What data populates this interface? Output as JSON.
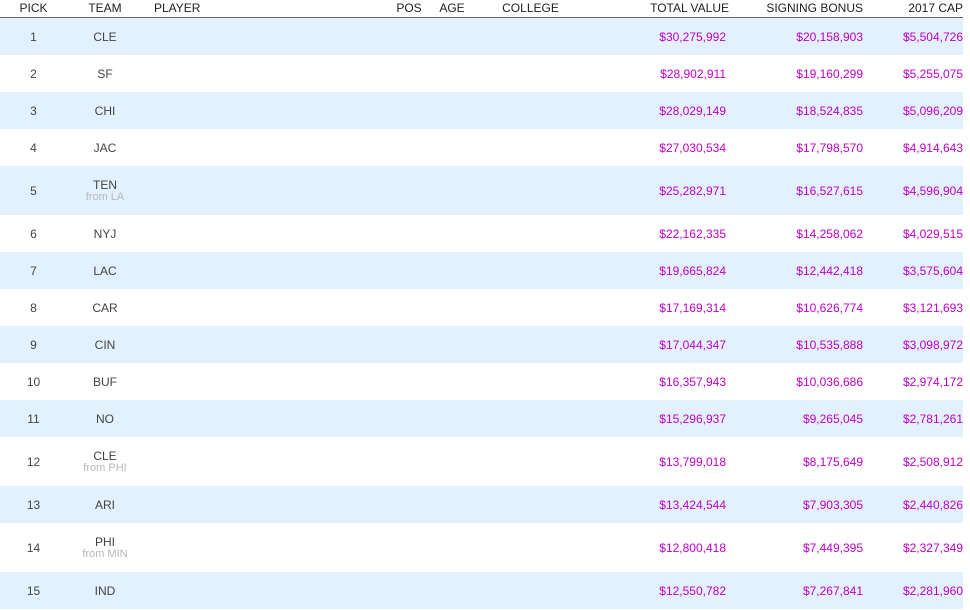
{
  "headers": {
    "pick": "PICK",
    "team": "TEAM",
    "player": "PLAYER",
    "pos": "POS",
    "age": "AGE",
    "college": "COLLEGE",
    "total_value": "TOTAL VALUE",
    "signing_bonus": "SIGNING BONUS",
    "cap_2017": "2017 CAP"
  },
  "colors": {
    "money": "#c000c8",
    "alt_row": "#e3f0fd",
    "from_text": "#b8b8b8"
  },
  "rows": [
    {
      "pick": "1",
      "team": "CLE",
      "from": "",
      "total": "$30,275,992",
      "bonus": "$20,158,903",
      "cap": "$5,504,726"
    },
    {
      "pick": "2",
      "team": "SF",
      "from": "",
      "total": "$28,902,911",
      "bonus": "$19,160,299",
      "cap": "$5,255,075"
    },
    {
      "pick": "3",
      "team": "CHI",
      "from": "",
      "total": "$28,029,149",
      "bonus": "$18,524,835",
      "cap": "$5,096,209"
    },
    {
      "pick": "4",
      "team": "JAC",
      "from": "",
      "total": "$27,030,534",
      "bonus": "$17,798,570",
      "cap": "$4,914,643"
    },
    {
      "pick": "5",
      "team": "TEN",
      "from": "from LA",
      "total": "$25,282,971",
      "bonus": "$16,527,615",
      "cap": "$4,596,904"
    },
    {
      "pick": "6",
      "team": "NYJ",
      "from": "",
      "total": "$22,162,335",
      "bonus": "$14,258,062",
      "cap": "$4,029,515"
    },
    {
      "pick": "7",
      "team": "LAC",
      "from": "",
      "total": "$19,665,824",
      "bonus": "$12,442,418",
      "cap": "$3,575,604"
    },
    {
      "pick": "8",
      "team": "CAR",
      "from": "",
      "total": "$17,169,314",
      "bonus": "$10,626,774",
      "cap": "$3,121,693"
    },
    {
      "pick": "9",
      "team": "CIN",
      "from": "",
      "total": "$17,044,347",
      "bonus": "$10,535,888",
      "cap": "$3,098,972"
    },
    {
      "pick": "10",
      "team": "BUF",
      "from": "",
      "total": "$16,357,943",
      "bonus": "$10,036,686",
      "cap": "$2,974,172"
    },
    {
      "pick": "11",
      "team": "NO",
      "from": "",
      "total": "$15,296,937",
      "bonus": "$9,265,045",
      "cap": "$2,781,261"
    },
    {
      "pick": "12",
      "team": "CLE",
      "from": "from PHI",
      "total": "$13,799,018",
      "bonus": "$8,175,649",
      "cap": "$2,508,912"
    },
    {
      "pick": "13",
      "team": "ARI",
      "from": "",
      "total": "$13,424,544",
      "bonus": "$7,903,305",
      "cap": "$2,440,826"
    },
    {
      "pick": "14",
      "team": "PHI",
      "from": "from MIN",
      "total": "$12,800,418",
      "bonus": "$7,449,395",
      "cap": "$2,327,349"
    },
    {
      "pick": "15",
      "team": "IND",
      "from": "",
      "total": "$12,550,782",
      "bonus": "$7,267,841",
      "cap": "$2,281,960"
    }
  ]
}
